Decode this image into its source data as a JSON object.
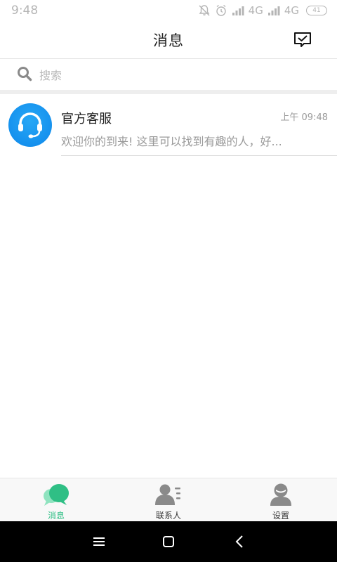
{
  "status_bar": {
    "time": "9:48",
    "network_1": "4G",
    "network_2": "4G",
    "battery": "41"
  },
  "header": {
    "title": "消息",
    "action_icon": "message-check-icon"
  },
  "search": {
    "placeholder": "搜索",
    "value": "",
    "icon": "search-icon"
  },
  "conversations": [
    {
      "name": "官方客服",
      "time": "上午 09:48",
      "preview": "欢迎你的到来! 这里可以找到有趣的人，好...",
      "avatar_icon": "headset-icon"
    }
  ],
  "bottom_nav": {
    "items": [
      {
        "label": "消息",
        "icon": "chat-bubbles-icon"
      },
      {
        "label": "联系人",
        "icon": "contacts-icon"
      },
      {
        "label": "设置",
        "icon": "settings-user-icon"
      }
    ],
    "active_index": 0
  },
  "colors": {
    "accent": "#2fbf85",
    "avatar_blue": "#1591ee",
    "text_primary": "#222222",
    "text_secondary": "#9a9a9a",
    "icon_gray": "#8a8a8a"
  }
}
